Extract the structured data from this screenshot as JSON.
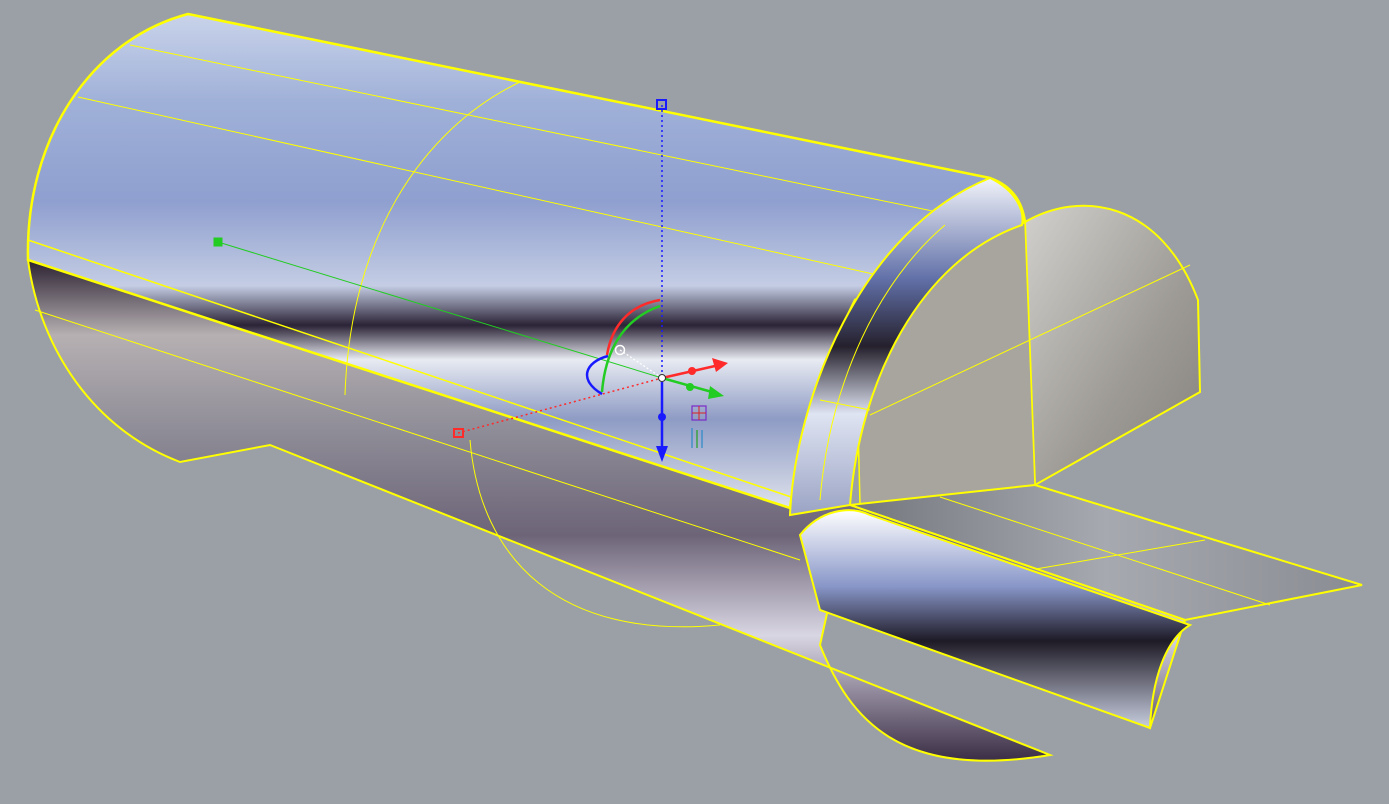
{
  "viewport": {
    "background": "#9aa0a6",
    "selection_color": "#ffff00",
    "display_mode": "rendered-chrome"
  },
  "scene": {
    "objects": [
      {
        "name": "cylinder-shell",
        "material": "chrome",
        "selected": true
      },
      {
        "name": "end-cap-surface",
        "material": "matte-gray",
        "selected": true
      },
      {
        "name": "fillet-lip",
        "material": "chrome",
        "selected": true
      },
      {
        "name": "flat-flange",
        "material": "dark-gray",
        "selected": true
      }
    ]
  },
  "gumball": {
    "visible": true,
    "axis_colors": {
      "x": "#ff2a2a",
      "y": "#22cc22",
      "z": "#1a1aff"
    },
    "icons": [
      "move-x-arrow-icon",
      "move-y-arrow-icon",
      "move-z-arrow-icon",
      "rotate-x-arc-icon",
      "rotate-y-arc-icon",
      "rotate-z-arc-icon",
      "scale-x-handle-icon",
      "scale-y-handle-icon",
      "scale-z-handle-icon",
      "gumball-origin-icon",
      "gumball-menu-icon"
    ]
  }
}
